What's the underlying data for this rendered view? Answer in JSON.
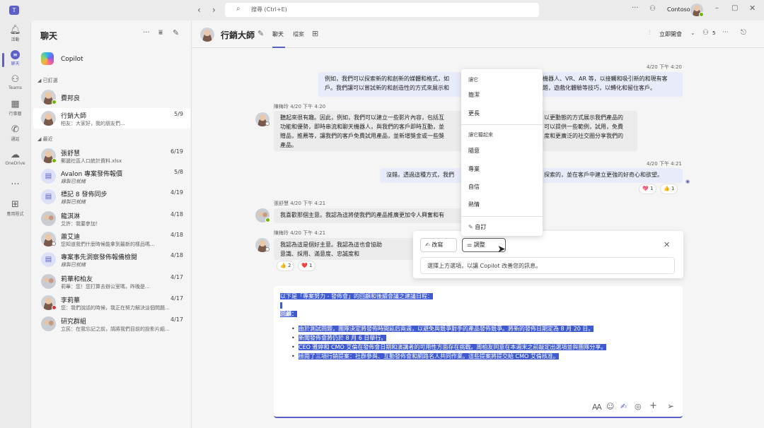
{
  "titlebar": {
    "search_placeholder": "搜尋 (Ctrl+E)",
    "org": "Contoso"
  },
  "rail": {
    "items": [
      {
        "label": "活動",
        "icon": "bell-icon"
      },
      {
        "label": "聊天",
        "icon": "chat-icon"
      },
      {
        "label": "Teams",
        "icon": "teams-icon"
      },
      {
        "label": "行事曆",
        "icon": "calendar-icon"
      },
      {
        "label": "通話",
        "icon": "phone-icon"
      },
      {
        "label": "OneDrive",
        "icon": "cloud-icon"
      },
      {
        "label": "應用程式",
        "icon": "apps-icon"
      }
    ],
    "more": "..."
  },
  "chatlist": {
    "title": "聊天",
    "copilot": "Copilot",
    "pinned_header": "已釘選",
    "recent_header": "最近",
    "pinned": [
      {
        "name": "費邦良",
        "preview": "",
        "date": ""
      },
      {
        "name": "行銷大師",
        "preview": "柏友：大家好，我的朋友們...",
        "date": "5/9"
      }
    ],
    "recent": [
      {
        "name": "張舒慧",
        "preview": "郵遞社區人口統計資料.xlsx",
        "date": "6/19"
      },
      {
        "name": "Avalon 專案發佈報價",
        "preview": "錄製已就緒",
        "date": "5/8"
      },
      {
        "name": "標記 8 發佈同步",
        "preview": "錄製已就緒",
        "date": "4/19"
      },
      {
        "name": "龍淇淋",
        "preview": "艾許：我要參加！",
        "date": "4/18"
      },
      {
        "name": "蕭艾迪",
        "preview": "您知道我們什麼時候能拿到最新的樣品嗎...",
        "date": "4/18"
      },
      {
        "name": "專案事先洞察發佈報備檢閱",
        "preview": "錄製已就緒",
        "date": "4/18"
      },
      {
        "name": "莉華和柏友",
        "preview": "莉華：您！您打算去辦公室嗎，昨晚是...",
        "date": "4/17"
      },
      {
        "name": "李莉華",
        "preview": "您：我們說話的時候，我正在努力解決這個問題...",
        "date": "4/17"
      },
      {
        "name": "研究群組",
        "preview": "立民：在我忘記之前，請將我們目前的投影片組...",
        "date": "4/17"
      }
    ]
  },
  "header": {
    "title": "行銷大師",
    "tabs": [
      "聊天",
      "檔案"
    ],
    "meet": "立即開會",
    "people_count": "5"
  },
  "messages": [
    {
      "time": "4/20 下午 4:20",
      "text1": "例如，我們可以探索新的和創新的媒體和格式，如",
      "text1b": "機器人、VR、AR 等，以接觸和吸引新的和現有客",
      "text2": "戶。我們讓可以嘗試新的和創造性的方式來展示和",
      "text2b": "題，遊戲化體驗等技巧，以轉化和留住客戶。"
    },
    {
      "author": "陳梅玲",
      "time": "4/20 下午 4:20",
      "text1": "聽起來很有趣。因此，例如，我們可以建立一些影片內容，包括互",
      "text1b": "以更動態的方式展示我們產品的",
      "text2": "功能和優勢，即時串流和聊天機器人，與我們的客戶即時互動，並",
      "text2b": "可以提供一些範例，試用，免費",
      "text3": "贈品，推薦等，讓我們的客戶免費試用產品，並新增獎金或一些獎",
      "text3b": "度和更廣泛的社交圈分享我們的",
      "text4": "產品。"
    },
    {
      "time": "4/20 下午 4:21",
      "text1": "沒錯。透過這種方式，我們",
      "text1b": "探索的，並在客戶中建立更強的好奇心和欲望。",
      "reactions": [
        {
          "emoji": "💖",
          "count": "1"
        },
        {
          "emoji": "👍",
          "count": "1"
        }
      ]
    },
    {
      "author": "張舒慧",
      "time": "4/20 下午 4:21",
      "text1": "我喜歡那個主意。我認為這將使我們的產品推廣更加令人興奮和有"
    },
    {
      "author": "陳梅玲",
      "time": "4/20 下午 4:21",
      "text1": "我認為這是個好主意。我認為這也會協助",
      "text2": "意識、採用、滿意度、忠誠度和",
      "reactions": [
        {
          "emoji": "👍",
          "count": "2"
        },
        {
          "emoji": "❤️",
          "count": "1"
        }
      ]
    }
  ],
  "rewrite_menu": {
    "section1": "讓它",
    "items1": [
      "簡潔",
      "更長"
    ],
    "section2": "讓它聽起來",
    "items2": [
      "隨意",
      "專業",
      "自信",
      "熱情"
    ],
    "custom": "自訂"
  },
  "copilot_bar": {
    "rewrite": "改寫",
    "adjust": "調整",
    "hint": "選擇上方選項，以讓 Copilot 改善您的訊息。"
  },
  "composer": {
    "intro": "以下是「專案努力 - 發佈會」的回顧和後續會議之建議日程：",
    "blank": "",
    "recap": "回顧：",
    "bullets": [
      "由於測試問題，團隊決定將發佈時間延后兩週，以避免與競爭對手的產品發佈競爭。將新的發佈日期定為 8 月 20 日。",
      "新聞發佈會將仍於 8 月 6 日舉行。",
      "CEO 雅婷和 CMO 艾倫在發佈會日期和演講者的可用性方面存在挑戰。周柏友同意在本週末之前敲定出選項並與團隊分享。",
      "檢閱了三項行銷提案：社群參與、互動發佈會和網路名人共同作業。這些提案將提交給 CMO 艾倫核准。"
    ]
  }
}
